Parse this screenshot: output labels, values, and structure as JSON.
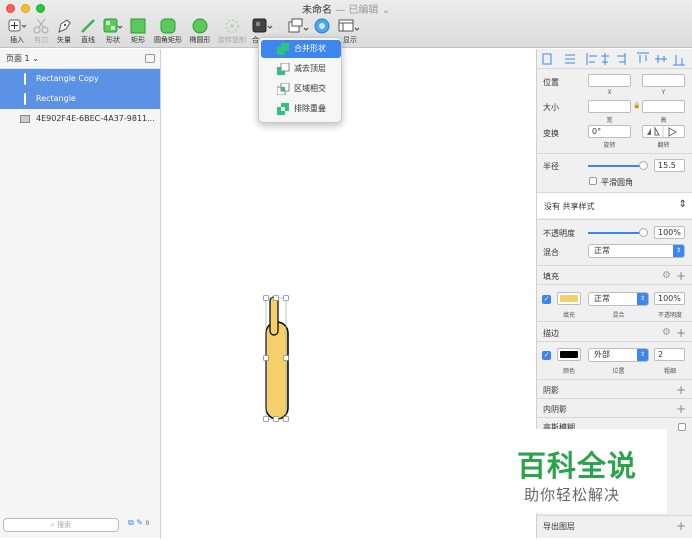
{
  "window": {
    "title": "未命名",
    "status": "— 已编辑"
  },
  "toolbar": {
    "insert": "插入",
    "scissors": "剪刀",
    "vector": "矢量",
    "line": "直线",
    "shape": "形状",
    "rect": "矩形",
    "rounded": "圆角矩形",
    "oval": "椭圆形",
    "rotate_copy": "旋转复制",
    "combine": "合",
    "display": "显示"
  },
  "dropdown": {
    "items": [
      "合并形状",
      "减去顶层",
      "区域相交",
      "排除重叠"
    ]
  },
  "sidebar": {
    "page": "页面 1",
    "layers": [
      "Rectangle Copy",
      "Rectangle",
      "4E902F4E-6BEC-4A37-9811..."
    ],
    "search_placeholder": "搜索",
    "count": "0"
  },
  "inspector": {
    "position": "位置",
    "x": "X",
    "y": "Y",
    "size": "大小",
    "width": "宽",
    "height": "高",
    "transform": "变换",
    "rotate_value": "0°",
    "rotate": "旋转",
    "flip": "翻转",
    "radius": "半径",
    "radius_value": "15.5",
    "smooth": "平滑圆角",
    "shared_style": "没有 共享样式",
    "opacity": "不透明度",
    "opacity_value": "100%",
    "blend": "混合",
    "blend_value": "正常",
    "fill": "填充",
    "fill_mode": "正常",
    "fill_opacity": "100%",
    "fill_lbl": "填充",
    "fill_blend_lbl": "混合",
    "fill_opacity_lbl": "不透明度",
    "border": "描边",
    "border_pos": "外部",
    "border_width": "2",
    "color_lbl": "颜色",
    "pos_lbl": "位置",
    "thick_lbl": "粗细",
    "shadow": "阴影",
    "inner_shadow": "内阴影",
    "blur": "高斯模糊",
    "export": "导出图层"
  },
  "colors": {
    "fill": "#f5cf6a",
    "border": "#000000",
    "accent": "#3d86f0"
  },
  "watermark": {
    "big": "百科全说",
    "small": "助你轻松解决"
  }
}
